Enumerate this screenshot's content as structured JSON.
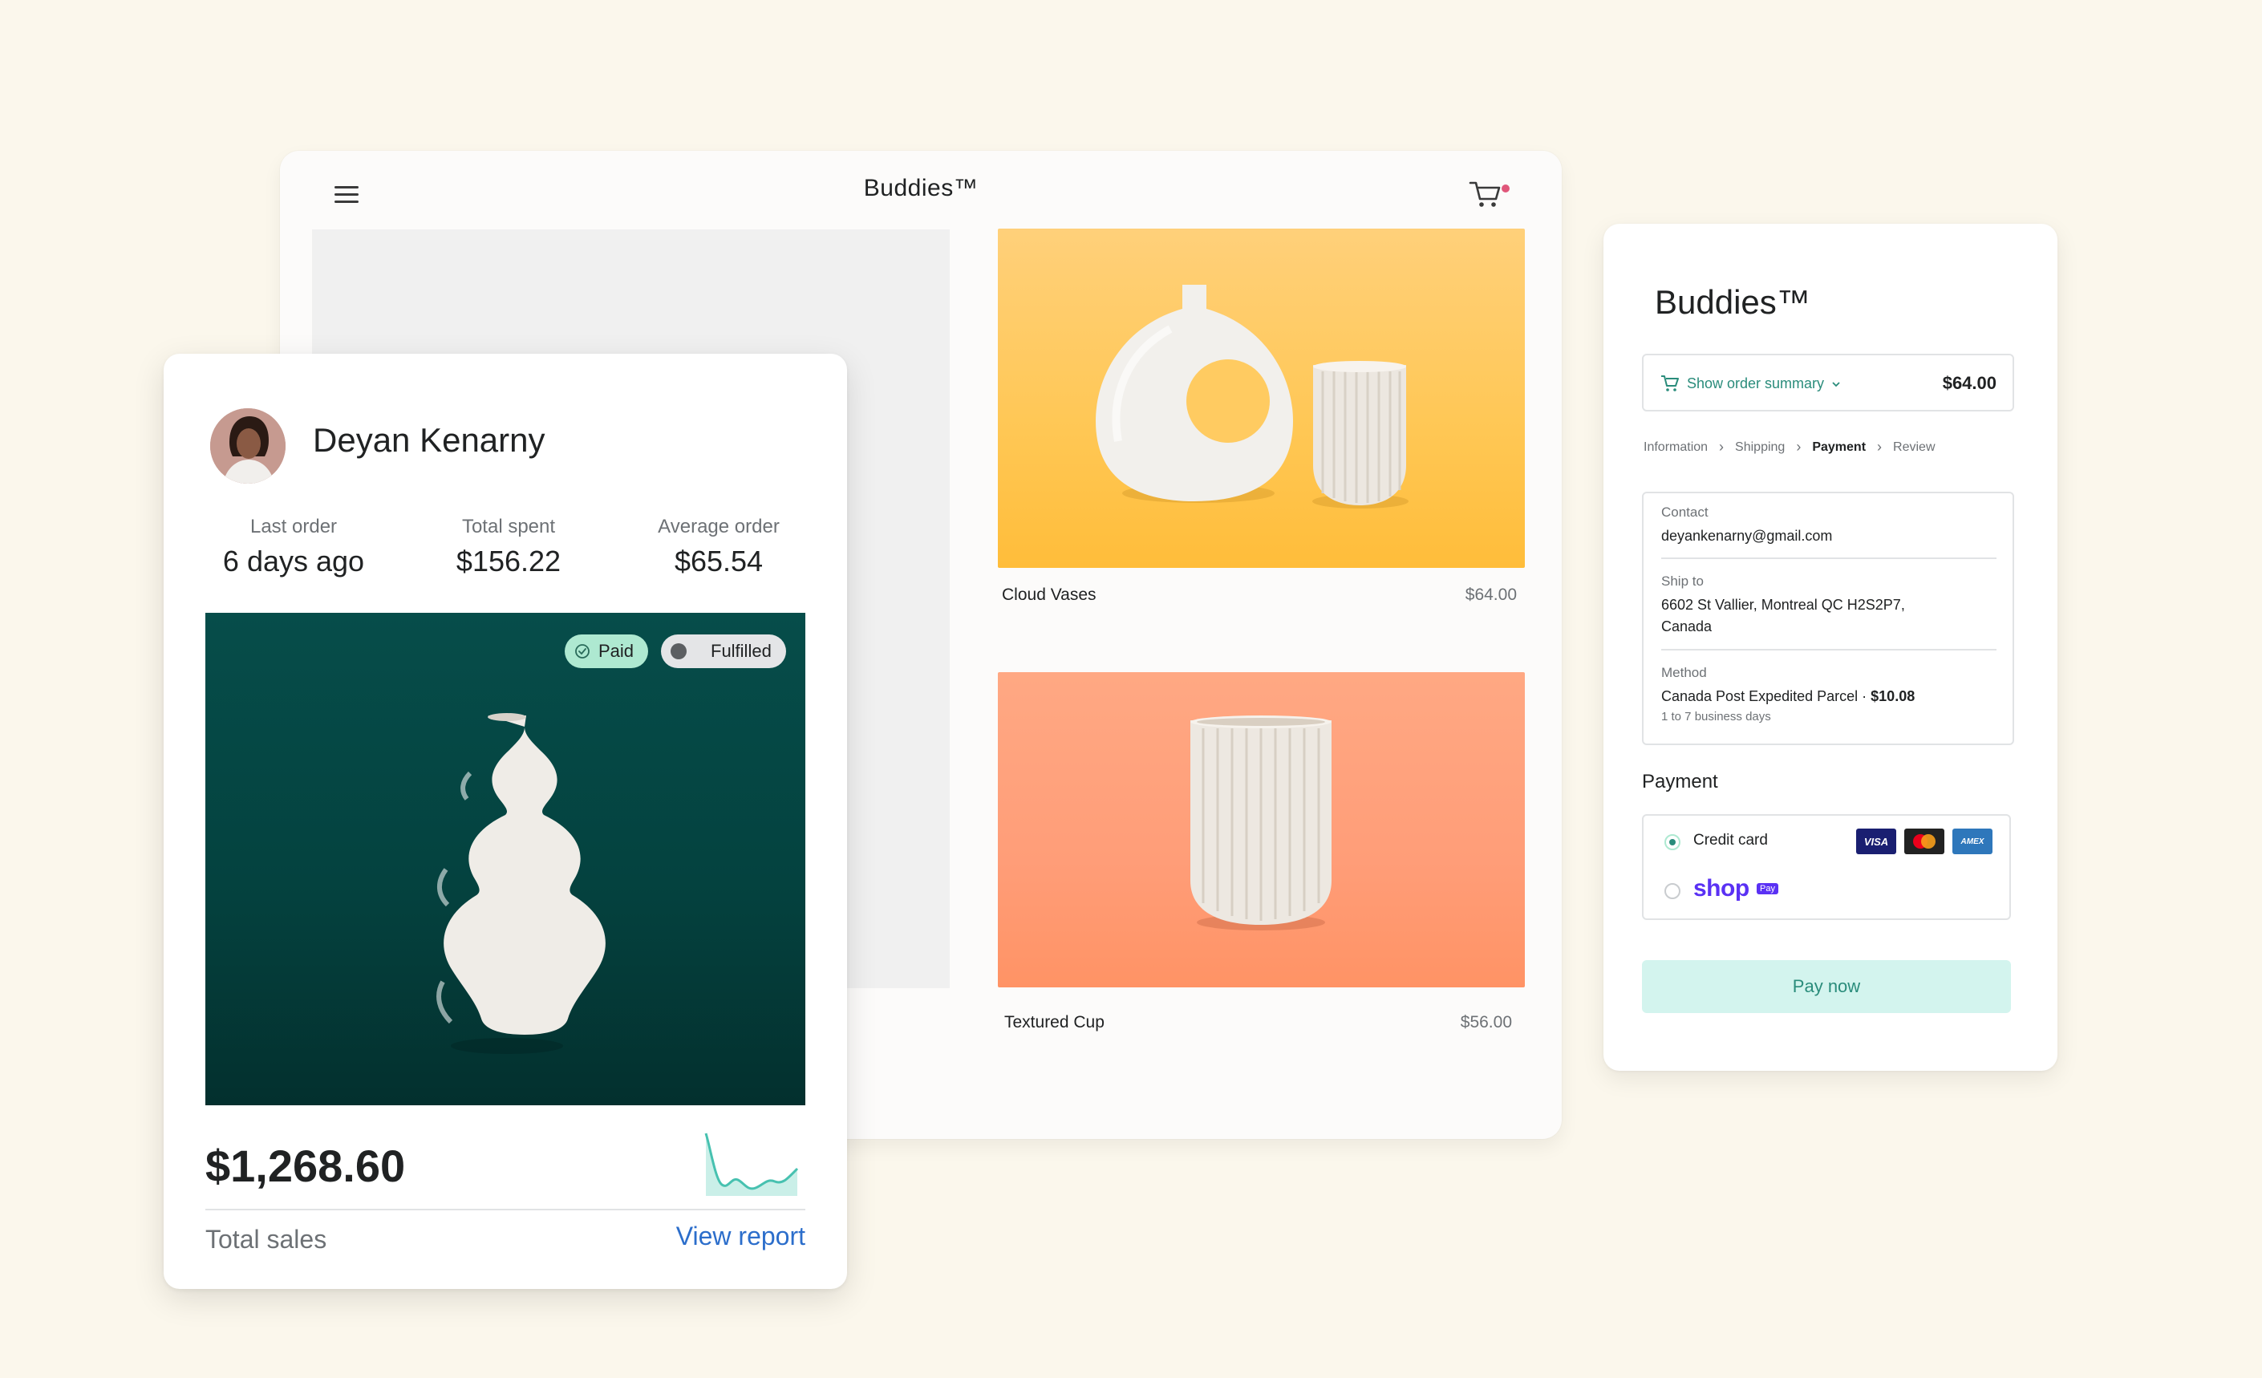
{
  "store": {
    "title": "Buddies™",
    "products": [
      {
        "name": "Cloud Vases",
        "price": "$64.00"
      },
      {
        "name": "Textured Cup",
        "price": "$56.00"
      }
    ]
  },
  "customer": {
    "name": "Deyan Kenarny",
    "stats": [
      {
        "label": "Last order",
        "value": "6 days ago"
      },
      {
        "label": "Total spent",
        "value": "$156.22"
      },
      {
        "label": "Average order",
        "value": "$65.54"
      }
    ],
    "badges": {
      "paid": "Paid",
      "fulfilled": "Fulfilled"
    },
    "total_sales_value": "$1,268.60",
    "total_sales_label": "Total sales",
    "view_report": "View report"
  },
  "checkout": {
    "title": "Buddies™",
    "summary_label": "Show order summary",
    "summary_total": "$64.00",
    "breadcrumb": [
      "Information",
      "Shipping",
      "Payment",
      "Review"
    ],
    "contact_label": "Contact",
    "contact_value": "deyankenarny@gmail.com",
    "ship_label": "Ship to",
    "ship_value": "6602 St Vallier, Montreal QC  H2S2P7, Canada",
    "method_label": "Method",
    "method_value": "Canada Post Expedited Parcel · ",
    "method_price": "$10.08",
    "method_note": "1 to 7 business days",
    "payment_heading": "Payment",
    "credit_card_label": "Credit card",
    "card_logos": [
      "VISA",
      "AMEX"
    ],
    "shop_word": "shop",
    "shop_pay": "Pay",
    "pay_button": "Pay now"
  },
  "colors": {
    "background": "#fbf7ec",
    "accent_teal": "#2a8c7b",
    "link_blue": "#2c6ecb",
    "shop_purple": "#5a31f4"
  }
}
